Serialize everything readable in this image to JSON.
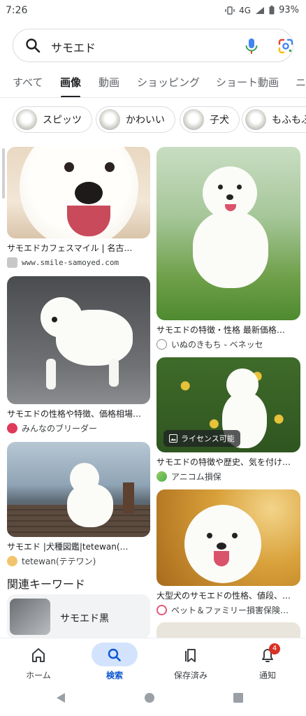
{
  "status": {
    "time": "7:26",
    "network": "4G",
    "battery": "93%"
  },
  "search": {
    "query": "サモエド"
  },
  "tabs": [
    "すべて",
    "画像",
    "動画",
    "ショッピング",
    "ショート動画",
    "ニ"
  ],
  "chips": [
    "スピッツ",
    "かわいい",
    "子犬",
    "もふもふ"
  ],
  "results_left": [
    {
      "title": "サモエドカフェスマイル | 名古…",
      "source": "www.smile-samoyed.com"
    },
    {
      "title": "サモエドの性格や特徴、価格相場…",
      "source": "みんなのブリーダー"
    },
    {
      "title": "サモエド  |犬種図鑑|tetewan(…",
      "source": "tetewan(テテワン)"
    }
  ],
  "results_right": [
    {
      "title": "サモエドの特徴・性格 最新価格…",
      "source": "いぬのきもち - ベネッセ"
    },
    {
      "title": "サモエドの特徴や歴史、気を付け…",
      "source": "アニコム損保",
      "badge": "ライセンス可能"
    },
    {
      "title": "大型犬のサモエドの性格、値段、…",
      "source": "ペット＆ファミリー損害保険…"
    }
  ],
  "related": {
    "heading": "関連キーワード",
    "item": "サモエド黒"
  },
  "bottom_nav": [
    {
      "label": "ホーム",
      "icon": "home-icon"
    },
    {
      "label": "検索",
      "icon": "search-icon"
    },
    {
      "label": "保存済み",
      "icon": "bookmarks-icon"
    },
    {
      "label": "通知",
      "icon": "bell-icon",
      "badge": "4"
    }
  ],
  "colors": {
    "accent": "#0b57d0",
    "active_pill": "#d3e3fd",
    "badge": "#d93025"
  }
}
